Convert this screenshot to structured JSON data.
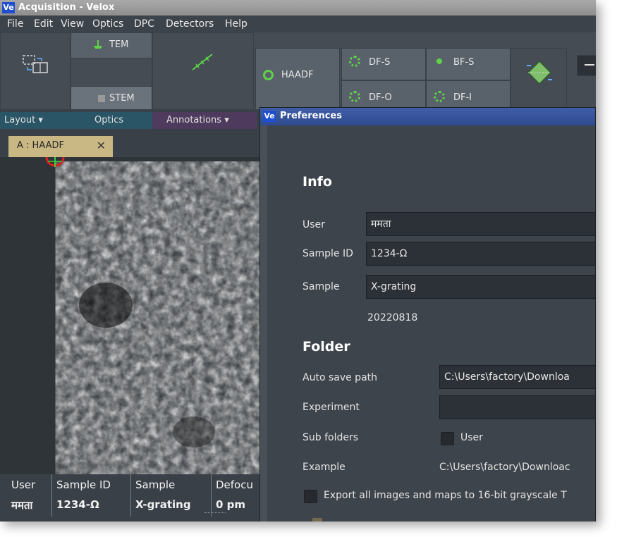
{
  "app": {
    "badge": "Ve",
    "title": "Acquisition - Velox"
  },
  "menu": [
    "File",
    "Edit",
    "View",
    "Optics",
    "DPC",
    "Detectors",
    "Help"
  ],
  "ribbon": {
    "tem_label": "TEM",
    "stem_label": "STEM",
    "haadf_label": "HAADF",
    "df_s_label": "DF-S",
    "bf_s_label": "BF-S",
    "df_o_label": "DF-O",
    "df_i_label": "DF-I",
    "groups": {
      "layout": "Layout ▾",
      "optics": "Optics",
      "annotations": "Annotations ▾"
    }
  },
  "doc_tab": {
    "label": "A : HAADF",
    "close": "✕"
  },
  "statusbar": {
    "user": {
      "header": "User",
      "value": "ममता"
    },
    "sample_id": {
      "header": "Sample ID",
      "value": "1234-Ω"
    },
    "sample": {
      "header": "Sample",
      "value": "X-grating"
    },
    "defocus": {
      "header": "Defocu",
      "value": "0 pm"
    }
  },
  "preferences": {
    "badge": "Ve",
    "title": "Preferences",
    "info": {
      "heading": "Info",
      "user_label": "User",
      "user_value": "ममता",
      "sample_id_label": "Sample ID",
      "sample_id_value": "1234-Ω",
      "sample_label": "Sample",
      "sample_value": "X-grating",
      "date": "20220818"
    },
    "folder": {
      "heading": "Folder",
      "auto_save_label": "Auto save path",
      "auto_save_value": "C:\\Users\\factory\\Downloa",
      "experiment_label": "Experiment",
      "experiment_value": "",
      "subfolders_label": "Sub folders",
      "subfolders_option": "User",
      "example_label": "Example",
      "example_value": "C:\\Users\\factory\\Downloac",
      "export_label": "Export all images and maps to 16-bit grayscale T"
    }
  },
  "colors": {
    "accent_green": "#5fd14a",
    "title_blue": "#1f4fd1",
    "tab_gold": "#c9b883"
  }
}
